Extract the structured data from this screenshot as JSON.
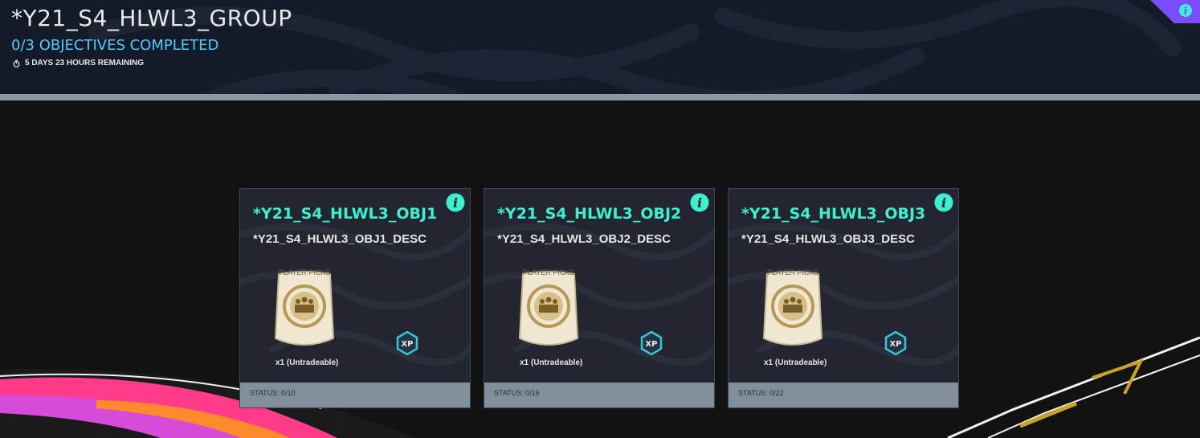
{
  "header": {
    "group_title": "*Y21_S4_HLWL3_GROUP",
    "objectives_completed": "0/3 OBJECTIVES COMPLETED",
    "time_remaining": "5 DAYS 23 HOURS REMAINING"
  },
  "colors": {
    "accent_teal": "#3ef0d1",
    "accent_blue": "#56c8ff",
    "corner_purple": "#7b4dff",
    "status_grey": "#838e9b"
  },
  "objectives": [
    {
      "title": "*Y21_S4_HLWL3_OBJ1",
      "description": "*Y21_S4_HLWL3_OBJ1_DESC",
      "pack_label": "PLAYER PICKS",
      "reward_quantity": "x1 (Untradeable)",
      "xp_label": "XP",
      "status": "STATUS: 0/10"
    },
    {
      "title": "*Y21_S4_HLWL3_OBJ2",
      "description": "*Y21_S4_HLWL3_OBJ2_DESC",
      "pack_label": "PLAYER PICKS",
      "reward_quantity": "x1 (Untradeable)",
      "xp_label": "XP",
      "status": "STATUS: 0/16"
    },
    {
      "title": "*Y21_S4_HLWL3_OBJ3",
      "description": "*Y21_S4_HLWL3_OBJ3_DESC",
      "pack_label": "PLAYER PICKS",
      "reward_quantity": "x1 (Untradeable)",
      "xp_label": "XP",
      "status": "STATUS: 0/22"
    }
  ],
  "icons": {
    "info": "info-icon",
    "stopwatch": "stopwatch-icon",
    "xp": "xp-icon",
    "pack": "player-picks-pack-icon"
  }
}
